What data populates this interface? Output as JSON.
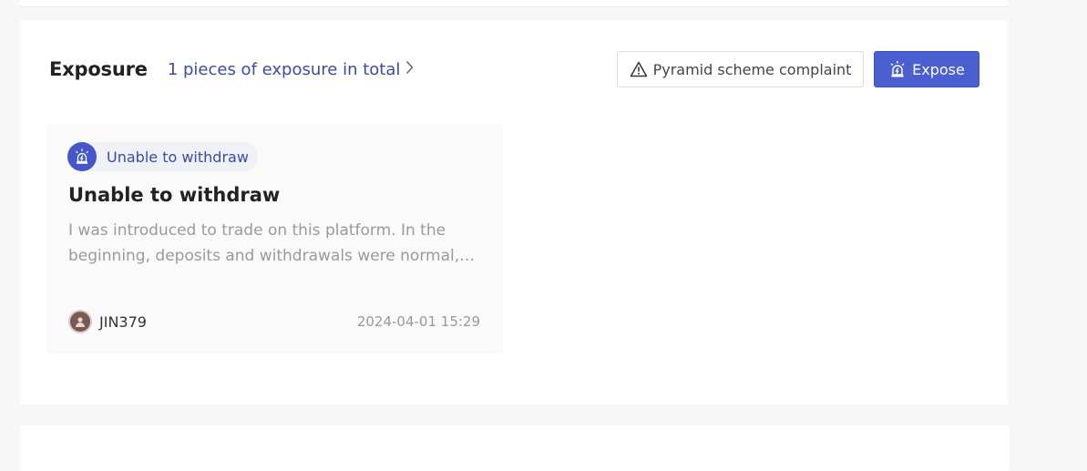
{
  "exposure": {
    "title": "Exposure",
    "total_link": "1 pieces of exposure in total",
    "complaint_button": "Pyramid scheme complaint",
    "expose_button": "Expose"
  },
  "card": {
    "tag": "Unable to withdraw",
    "title": "Unable to withdraw",
    "description": "I was introduced to trade on this platform. In the beginning, deposits and withdrawals were normal, but later I was unable to withdraw.",
    "user": "JIN379",
    "date": "2024-04-01 15:29"
  },
  "icons": {
    "total_link_chevron": "chevron-right-icon",
    "complaint": "warning-triangle-icon",
    "expose": "alarm-siren-icon",
    "tag": "alarm-siren-icon",
    "avatar": "user-avatar"
  },
  "colors": {
    "accent": "#4b5fd1",
    "link": "#3b4ba8",
    "tag_bg": "#eff1f7"
  }
}
